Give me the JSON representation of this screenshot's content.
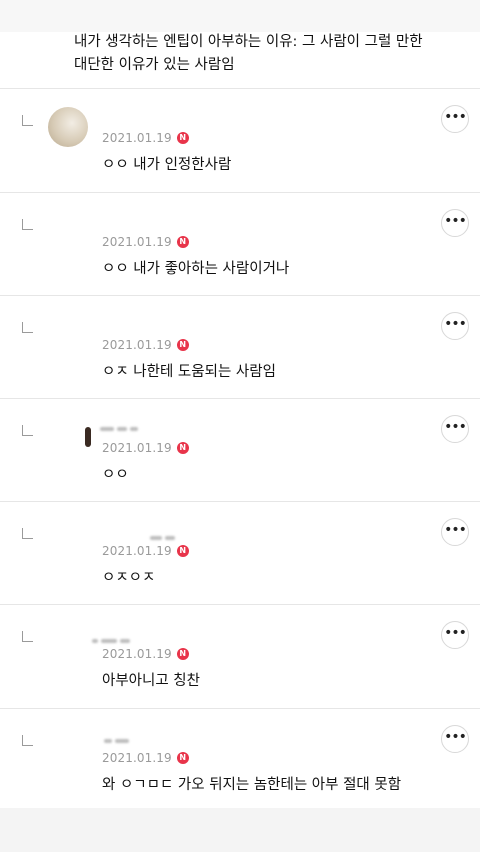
{
  "parent_comment": {
    "text": "내가 생각하는 엔팁이 아부하는 이유: 그 사람이 그럴 만한\n대단한 이유가 있는 사람임"
  },
  "badge_label": "N",
  "more_label": "•••",
  "replies": [
    {
      "date": "2021.01.19",
      "text": "ㅇㅇ 내가 인정한사람"
    },
    {
      "date": "2021.01.19",
      "text": "ㅇㅇ 내가 좋아하는 사람이거나"
    },
    {
      "date": "2021.01.19",
      "text": "ㅇㅈ 나한테 도움되는 사람임"
    },
    {
      "date": "2021.01.19",
      "text": "ㅇㅇ"
    },
    {
      "date": "2021.01.19",
      "text": "ㅇㅈㅇㅈ"
    },
    {
      "date": "2021.01.19",
      "text": "아부아니고 칭찬"
    },
    {
      "date": "2021.01.19",
      "text": "와 ㅇㄱㅁㄷ 가오 뒤지는 놈한테는 아부 절대 못함"
    }
  ]
}
